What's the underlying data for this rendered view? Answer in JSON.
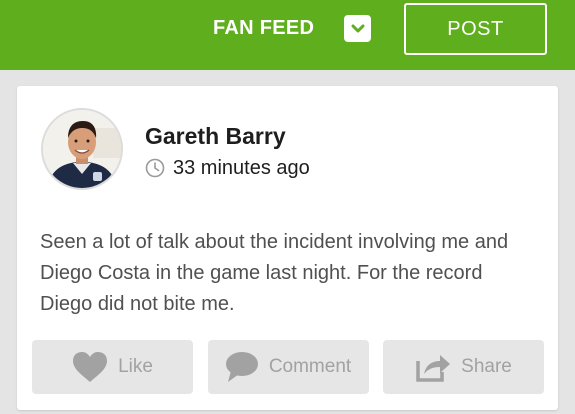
{
  "header": {
    "feed_title": "FAN FEED",
    "post_label": "POST",
    "colors": {
      "brand": "#5fae1d",
      "text": "#ffffff"
    }
  },
  "post": {
    "author": "Gareth Barry",
    "timestamp": "33 minutes ago",
    "text": "Seen a lot of talk about the incident involving me and Diego Costa in the game last night.  For the record Diego did not bite me.",
    "avatar_icon": "user-photo",
    "actions": [
      {
        "label": "Like",
        "icon": "heart-icon"
      },
      {
        "label": "Comment",
        "icon": "speech-bubble-icon"
      },
      {
        "label": "Share",
        "icon": "share-arrow-icon"
      }
    ]
  },
  "colors": {
    "background": "#e4e4e4",
    "card": "#ffffff",
    "action_bg": "#e6e6e6",
    "action_text": "#a2a2a2"
  }
}
